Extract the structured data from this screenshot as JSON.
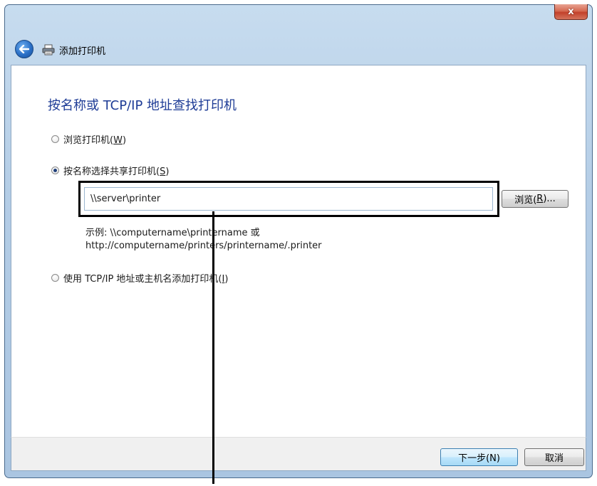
{
  "window": {
    "title": "添加打印机",
    "close_label": "x"
  },
  "page": {
    "heading": "按名称或 TCP/IP 地址查找打印机"
  },
  "options": {
    "browse": {
      "text": "浏览打印机(",
      "key": "W",
      "close": ")",
      "selected": false
    },
    "by_name": {
      "text": "按名称选择共享打印机(",
      "key": "S",
      "close": ")",
      "selected": true
    },
    "tcpip": {
      "text": "使用 TCP/IP 地址或主机名添加打印机(",
      "key": "I",
      "close": ")",
      "selected": false
    }
  },
  "printer_path": {
    "value": "\\\\server\\printer"
  },
  "browse_button": {
    "text": "浏览(",
    "key": "R",
    "close": ")..."
  },
  "example": {
    "line1": "示例: \\\\computername\\printername 或",
    "line2": "http://computername/printers/printername/.printer"
  },
  "footer": {
    "next_label": "下一步(N)",
    "cancel_label": "取消"
  },
  "colors": {
    "heading": "#1e3c96",
    "title_bar": "#b4cde6",
    "close_button": "#c2412b"
  }
}
